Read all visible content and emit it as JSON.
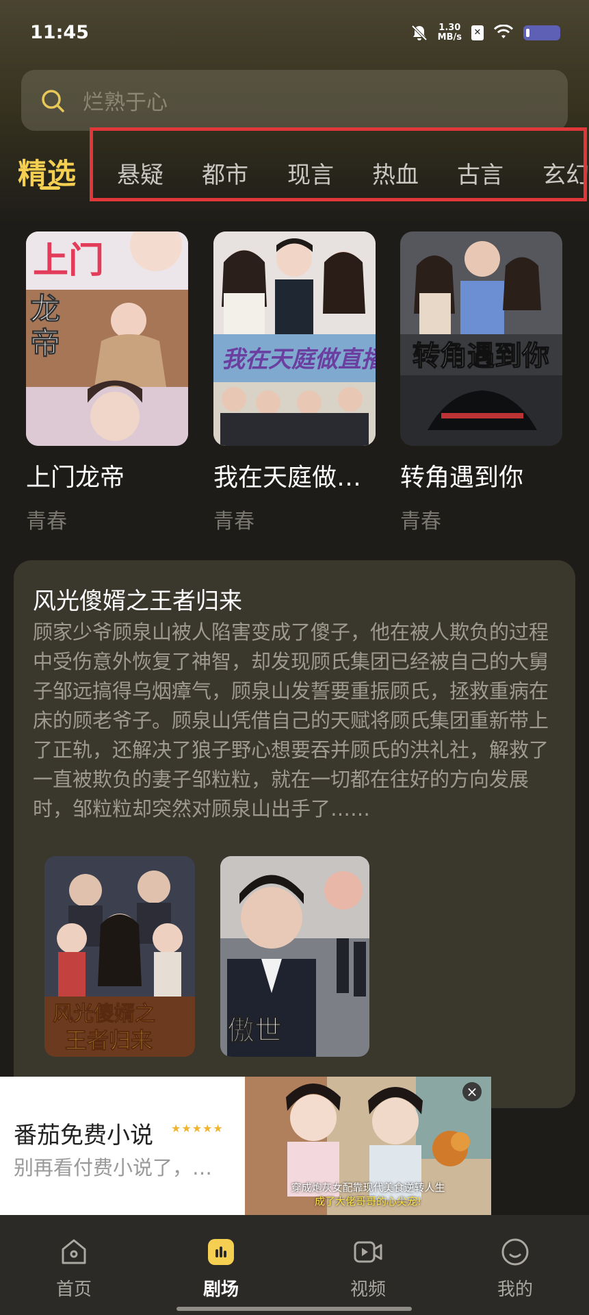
{
  "status_bar": {
    "time": "11:45",
    "speed_value": "1.30",
    "speed_unit": "MB/s"
  },
  "search": {
    "placeholder": "烂熟于心"
  },
  "tabs": {
    "featured": "精选",
    "items": [
      "悬疑",
      "都市",
      "现言",
      "热血",
      "古言",
      "玄幻"
    ]
  },
  "top_dramas": [
    {
      "title": "上门龙帝",
      "tag": "青春",
      "poster_text": "上门龙帝"
    },
    {
      "title": "我在天庭做…",
      "tag": "青春",
      "poster_text": "我在天庭做直播"
    },
    {
      "title": "转角遇到你",
      "tag": "青春",
      "poster_text": "转角遇到你"
    }
  ],
  "featured_card": {
    "title": "风光傻婿之王者归来",
    "description": "顾家少爷顾泉山被人陷害变成了傻子，他在被人欺负的过程中受伤意外恢复了神智，却发现顾氏集团已经被自己的大舅子邹远搞得乌烟瘴气，顾泉山发誓要重振顾氏，拯救重病在床的顾老爷子。顾泉山凭借自己的天赋将顾氏集团重新带上了正轨，还解决了狼子野心想要吞并顾氏的洪礼社，解救了一直被欺负的妻子邹粒粒，就在一切都在往好的方向发展时，邹粒粒却突然对顾泉山出手了……",
    "posters": [
      {
        "poster_text": "风光傻婿之王者归来"
      },
      {
        "poster_text": "傲世"
      }
    ]
  },
  "ad": {
    "title": "番茄免费小说",
    "stars": "★★★★★",
    "subtitle": "别再看付费小说了，…",
    "close": "×",
    "caption_line1": "穿成炮灰女配靠现代美食逆转人生",
    "caption_line2": "成了大佬哥哥的心尖宠!"
  },
  "bottom_nav": [
    {
      "label": "首页",
      "icon": "home-icon",
      "active": false
    },
    {
      "label": "剧场",
      "icon": "theater-icon",
      "active": true
    },
    {
      "label": "视频",
      "icon": "video-icon",
      "active": false
    },
    {
      "label": "我的",
      "icon": "profile-icon",
      "active": false
    }
  ],
  "colors": {
    "accent": "#f4cf52",
    "highlight_box": "#e0383a",
    "background": "#1d1c18",
    "card": "#3a372d"
  }
}
